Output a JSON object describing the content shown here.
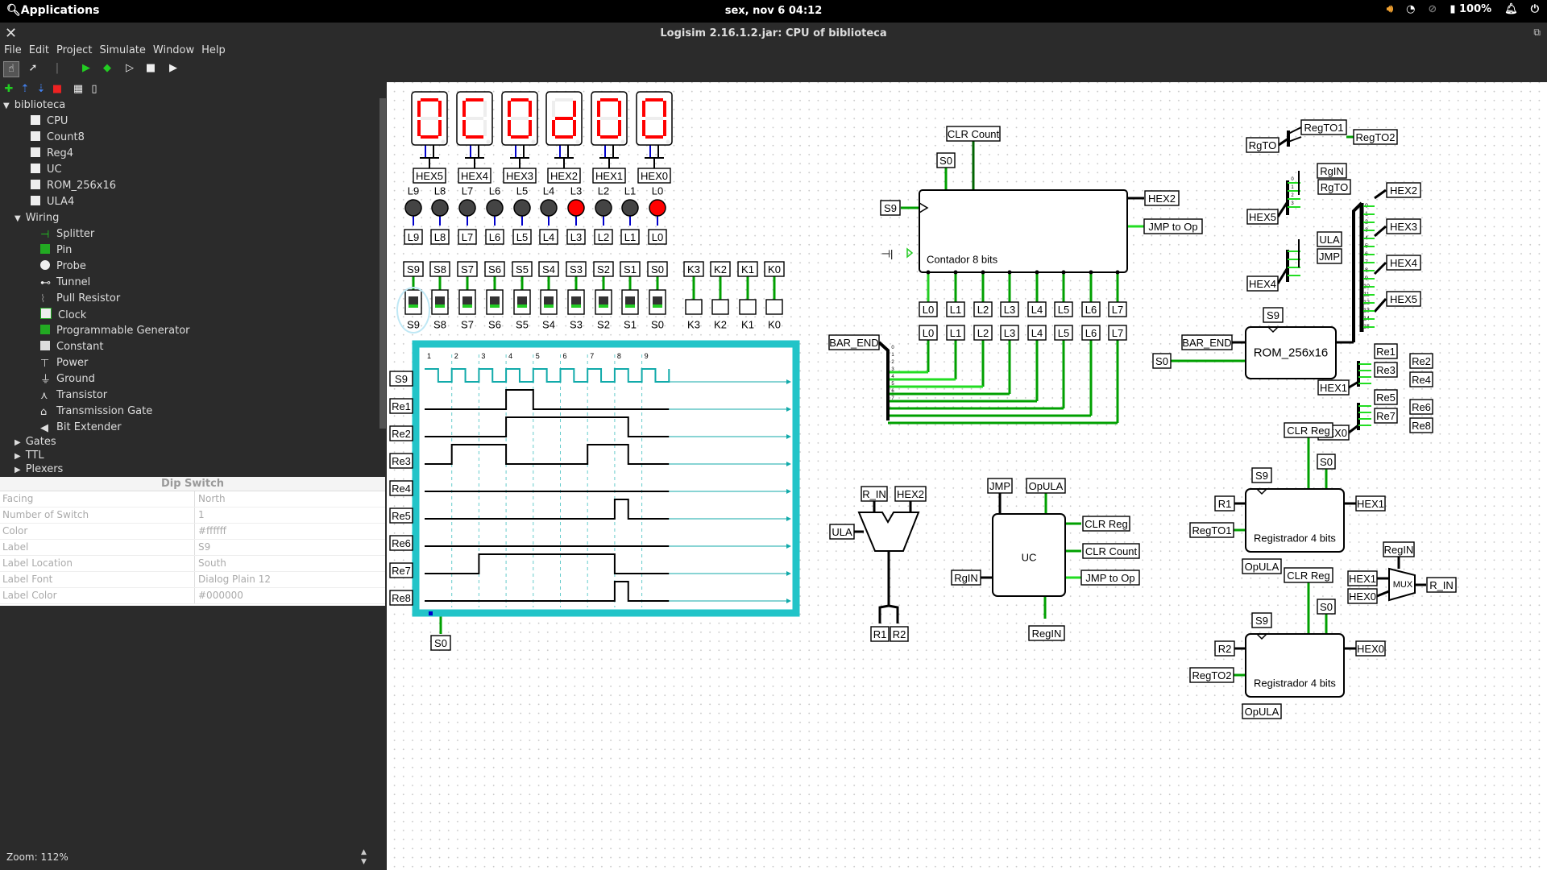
{
  "system_bar": {
    "apps": "Applications",
    "clock": "sex, nov  6   04:12",
    "battery": "100%"
  },
  "window": {
    "title": "Logisim 2.16.1.2.jar: CPU of biblioteca"
  },
  "menu": [
    "File",
    "Edit",
    "Project",
    "Simulate",
    "Window",
    "Help"
  ],
  "tree": {
    "root": "biblioteca",
    "circuits": [
      "CPU",
      "Count8",
      "Reg4",
      "UC",
      "ROM_256x16",
      "ULA4"
    ],
    "wiring_label": "Wiring",
    "wiring_items": [
      "Splitter",
      "Pin",
      "Probe",
      "Tunnel",
      "Pull Resistor",
      "Clock",
      "Programmable Generator",
      "Constant",
      "Power",
      "Ground",
      "Transistor",
      "Transmission Gate",
      "Bit Extender"
    ],
    "other_folders": [
      "Gates",
      "TTL",
      "Plexers"
    ]
  },
  "attributes": {
    "header": "Dip Switch",
    "rows": [
      {
        "key": "Facing",
        "value": "North"
      },
      {
        "key": "Number of Switch",
        "value": "1"
      },
      {
        "key": "Color",
        "value": "#ffffff"
      },
      {
        "key": "Label",
        "value": "S9"
      },
      {
        "key": "Label Location",
        "value": "South"
      },
      {
        "key": "Label Font",
        "value": "Dialog Plain 12"
      },
      {
        "key": "Label Color",
        "value": "#000000"
      }
    ]
  },
  "zoom": "Zoom: 112%",
  "circuit": {
    "hex_labels": [
      "HEX5",
      "HEX4",
      "HEX3",
      "HEX2",
      "HEX1",
      "HEX0"
    ],
    "hex_digits": [
      "0",
      "C",
      "0",
      "d",
      "0",
      "0"
    ],
    "led_labels": [
      "L9",
      "L8",
      "L7",
      "L6",
      "L5",
      "L4",
      "L3",
      "L2",
      "L1",
      "L0"
    ],
    "led_on": [
      false,
      false,
      false,
      false,
      false,
      false,
      true,
      false,
      false,
      true
    ],
    "switch_labels": [
      "S9",
      "S8",
      "S7",
      "S6",
      "S5",
      "S4",
      "S3",
      "S2",
      "S1",
      "S0"
    ],
    "key_labels": [
      "K3",
      "K2",
      "K1",
      "K0"
    ],
    "timing_signals": [
      "S9",
      "Re1",
      "Re2",
      "Re3",
      "Re4",
      "Re5",
      "Re6",
      "Re7",
      "Re8"
    ],
    "timing_ticks": [
      "1",
      "2",
      "3",
      "4",
      "5",
      "6",
      "7",
      "8",
      "9"
    ],
    "timing_clock": "S0",
    "counter": {
      "name": "Contador 8 bits",
      "clr": "CLR Count",
      "clk": "S0",
      "en": "S9",
      "out1": "HEX2",
      "out2": "JMP to Op",
      "bus": "BAR_END",
      "l_outputs": [
        "L0",
        "L1",
        "L2",
        "L3",
        "L4",
        "L5",
        "L6",
        "L7"
      ]
    },
    "rom": {
      "name": "ROM_256x16",
      "addr": "BAR_END",
      "clk": "S0",
      "en": "S9",
      "regto_left": "RgTO",
      "regto1": "RegTO1",
      "regto2": "RegTO2",
      "hex5_in": "HEX5",
      "hex5_outs": [
        "RgIN",
        "RgTO"
      ],
      "hex4_in": "HEX4",
      "hex4_outs": [
        "ULA",
        "JMP"
      ],
      "outs": [
        "HEX2",
        "HEX3",
        "HEX4",
        "HEX5"
      ],
      "hex1_in": "HEX1",
      "hex1_outs": [
        "Re1",
        "Re2",
        "Re3",
        "Re4"
      ],
      "hex0_in": "HEX0",
      "hex0_outs": [
        "Re5",
        "Re6",
        "Re7",
        "Re8"
      ]
    },
    "ula": {
      "in1": "R_IN",
      "in2": "HEX2",
      "ctrl": "ULA",
      "outs": [
        "R1",
        "R2"
      ]
    },
    "uc": {
      "name": "UC",
      "in_top": [
        "JMP",
        "OpULA"
      ],
      "in_left": "RgIN",
      "outs": [
        "CLR Reg",
        "CLR Count",
        "JMP to Op"
      ],
      "bottom": "RegIN"
    },
    "reg1": {
      "name": "Registrador 4 bits",
      "clr": "CLR Reg",
      "en": "S9",
      "clk": "S0",
      "in": "R1",
      "sel": "RegTO1",
      "out": "HEX1",
      "op": "OpULA"
    },
    "reg2": {
      "name": "Registrador 4 bits",
      "clr": "CLR Reg",
      "en": "S9",
      "clk": "S0",
      "in": "R2",
      "sel": "RegTO2",
      "out": "HEX0",
      "op": "OpULA"
    },
    "mux": {
      "name": "MUX",
      "sel": "RegIN",
      "in1": "HEX1",
      "in0": "HEX0",
      "out": "R_IN"
    }
  }
}
